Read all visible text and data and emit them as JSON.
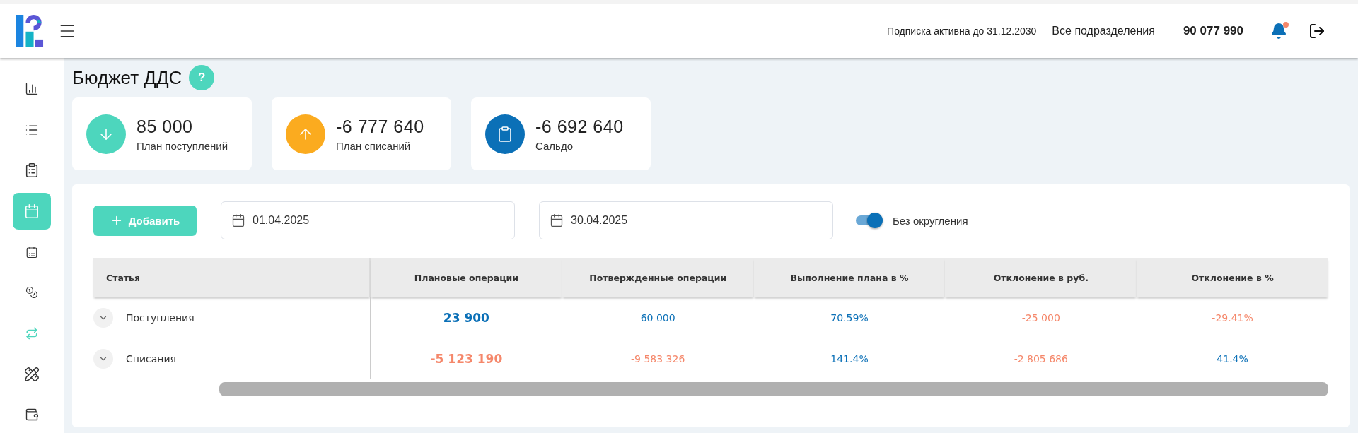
{
  "header": {
    "subscription": "Подписка активна до 31.12.2030",
    "division": "Все подразделения",
    "balance": "90 077 990",
    "notifications_unread": true
  },
  "sidebar": {
    "items": [
      {
        "kind": "chart",
        "selected": false,
        "highlighted": false
      },
      {
        "kind": "list",
        "selected": false,
        "highlighted": false
      },
      {
        "kind": "clipboard",
        "selected": false,
        "highlighted": false
      },
      {
        "kind": "calendar",
        "selected": true,
        "highlighted": false
      },
      {
        "kind": "day",
        "selected": false,
        "highlighted": false
      },
      {
        "kind": "coins",
        "selected": false,
        "highlighted": false
      },
      {
        "kind": "exchange",
        "selected": false,
        "highlighted": true
      },
      {
        "kind": "tools",
        "selected": false,
        "highlighted": false
      },
      {
        "kind": "wallet",
        "selected": false,
        "highlighted": false
      }
    ]
  },
  "page": {
    "title": "Бюджет ДДС",
    "help": "?"
  },
  "summary": [
    {
      "kind": "income",
      "value": "85 000",
      "label": "План поступлений",
      "color": "#4dd6bd"
    },
    {
      "kind": "expense",
      "value": "-6 777 640",
      "label": "План списаний",
      "color": "#fbab1f"
    },
    {
      "kind": "balance",
      "value": "-6 692 640",
      "label": "Сальдо",
      "color": "#0b70b7"
    }
  ],
  "toolbar": {
    "add_button": "Добавить",
    "date_from": "01.04.2025",
    "date_to": "30.04.2025",
    "no_rounding": {
      "label": "Без округления",
      "on": true
    }
  },
  "table": {
    "columns": [
      "Статья",
      "Плановые операции",
      "Потвержденные операции",
      "Выполнение плана в %",
      "Отклонение в руб.",
      "Отклонение в %"
    ],
    "rows": [
      {
        "expanded": false,
        "cells": [
          {
            "text": "Поступления"
          },
          {
            "text": "23 900",
            "color": "#0b70b7"
          },
          {
            "text": "60 000",
            "color": "#0b70b7"
          },
          {
            "text": "70.59%",
            "color": "#0b70b7"
          },
          {
            "text": "-25 000",
            "color": "#f5876a"
          },
          {
            "text": "-29.41%",
            "color": "#f5876a"
          }
        ]
      },
      {
        "expanded": false,
        "cells": [
          {
            "text": "Списания"
          },
          {
            "text": "-5 123 190",
            "color": "#f5876a"
          },
          {
            "text": "-9 583 326",
            "color": "#f5876a"
          },
          {
            "text": "141.4%",
            "color": "#0b70b7"
          },
          {
            "text": "-2 805 686",
            "color": "#f5876a"
          },
          {
            "text": "41.4%",
            "color": "#0b70b7"
          }
        ]
      }
    ]
  }
}
